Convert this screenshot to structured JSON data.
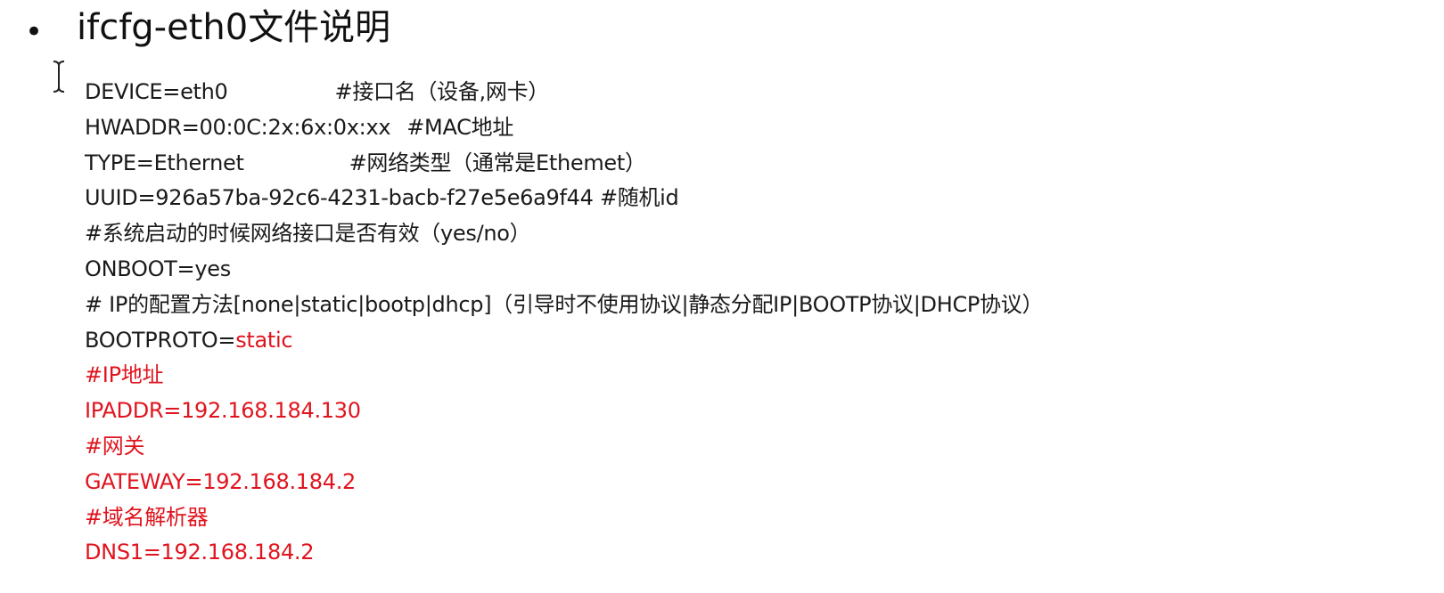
{
  "bullet": "•",
  "title": "ifcfg-eth0文件说明",
  "colors": {
    "text": "#1a1a1a",
    "highlight": "#e0141e"
  },
  "lines": {
    "device": "DEVICE=eth0",
    "device_comment": "#接口名（设备,网卡）",
    "hwaddr": "HWADDR=00:0C:2x:6x:0x:xx",
    "hwaddr_comment": "#MAC地址",
    "type": "TYPE=Ethernet",
    "type_comment": "#网络类型（通常是Ethemet）",
    "uuid": "UUID=926a57ba-92c6-4231-bacb-f27e5e6a9f44 #随机id",
    "onboot_comment": "#系统启动的时候网络接口是否有效（yes/no）",
    "onboot": "ONBOOT=yes",
    "bootproto_comment": "# IP的配置方法[none|static|bootp|dhcp]（引导时不使用协议|静态分配IP|BOOTP协议|DHCP协议）",
    "bootproto_key": "BOOTPROTO=",
    "bootproto_value": "static",
    "ipaddr_comment": "#IP地址",
    "ipaddr": "IPADDR=192.168.184.130",
    "gateway_comment": "#网关",
    "gateway": "GATEWAY=192.168.184.2",
    "dns_comment": "#域名解析器",
    "dns": "DNS1=192.168.184.2"
  }
}
